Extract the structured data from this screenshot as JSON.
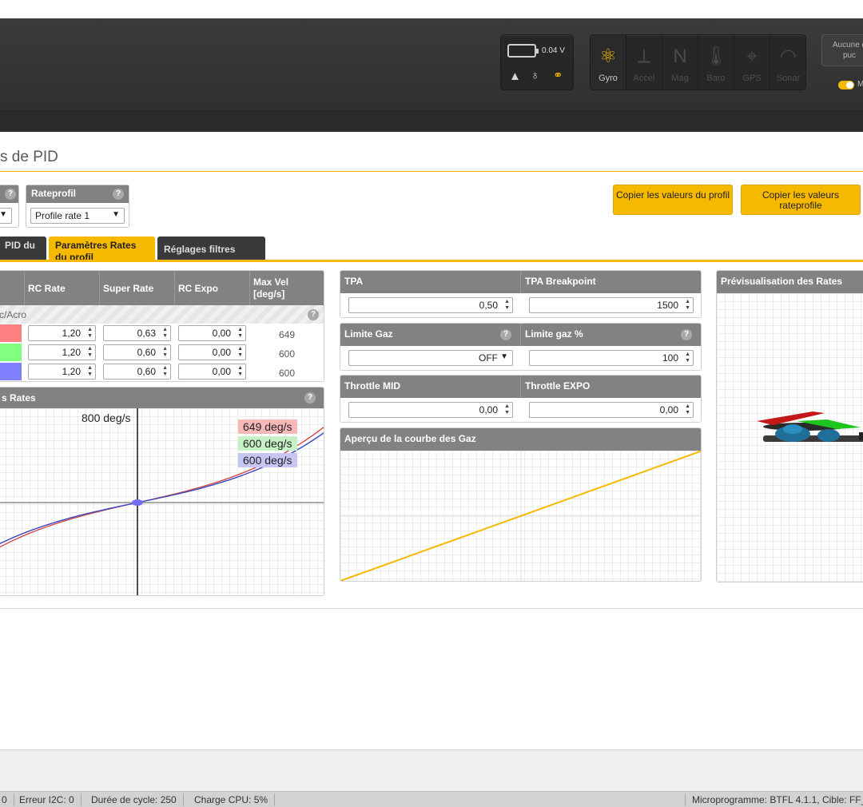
{
  "header": {
    "battery_voltage": "0.04 V",
    "sensors": [
      {
        "label": "Gyro",
        "icon": "gyro-icon",
        "active": true
      },
      {
        "label": "Accel",
        "icon": "accel-icon",
        "active": false
      },
      {
        "label": "Mag",
        "icon": "mag-icon",
        "active": false
      },
      {
        "label": "Baro",
        "icon": "baro-icon",
        "active": false
      },
      {
        "label": "GPS",
        "icon": "gps-icon",
        "active": false
      },
      {
        "label": "Sonar",
        "icon": "sonar-icon",
        "active": false
      }
    ],
    "connect_button_line1": "Aucune d",
    "connect_button_line2": "puc",
    "toggle_label": "M",
    "accent_color": "#f6b900"
  },
  "page": {
    "title": "s de PID"
  },
  "profiles": {
    "rateprofile_label": "Rateprofil",
    "rateprofile_value": "Profile rate 1",
    "copy_profile_button": "Copier les valeurs du profil",
    "copy_rateprofile_button": "Copier les valeurs rateprofile"
  },
  "tabs": [
    {
      "label": "PID du",
      "active": false
    },
    {
      "label": "Paramètres Rates du profil",
      "active": true
    },
    {
      "label": "Réglages filtres",
      "active": false
    }
  ],
  "rates_table": {
    "headers": [
      "RC Rate",
      "Super Rate",
      "RC Expo",
      "Max Vel [deg/s]"
    ],
    "subheader": "c/Acro",
    "rows": [
      {
        "axis_color": "#ff8080",
        "rc_rate": "1,20",
        "super_rate": "0,63",
        "rc_expo": "0,00",
        "max_vel": "649"
      },
      {
        "axis_color": "#80ff80",
        "rc_rate": "1,20",
        "super_rate": "0,60",
        "rc_expo": "0,00",
        "max_vel": "600"
      },
      {
        "axis_color": "#8080ff",
        "rc_rate": "1,20",
        "super_rate": "0,60",
        "rc_expo": "0,00",
        "max_vel": "600"
      }
    ]
  },
  "rates_graph": {
    "title": "s Rates",
    "top_label": "800 deg/s",
    "legend": [
      {
        "text": "649 deg/s",
        "color": "#f7b8b8",
        "line": "#d04040",
        "max": 649
      },
      {
        "text": "600 deg/s",
        "color": "#c6f0c6",
        "line": "#40c040",
        "max": 600
      },
      {
        "text": "600 deg/s",
        "color": "#c6c6f4",
        "line": "#4040d0",
        "max": 600
      }
    ]
  },
  "throttle": {
    "tpa_label": "TPA",
    "tpa_value": "0,50",
    "tpa_breakpoint_label": "TPA Breakpoint",
    "tpa_breakpoint_value": "1500",
    "limit_label": "Limite Gaz",
    "limit_value": "OFF",
    "limit_percent_label": "Limite gaz %",
    "limit_percent_value": "100",
    "mid_label": "Throttle MID",
    "mid_value": "0,00",
    "expo_label": "Throttle EXPO",
    "expo_value": "0,00",
    "curve_title": "Aperçu de la courbe des Gaz",
    "curve_color": "#f6b900"
  },
  "preview": {
    "title": "Prévisualisation des Rates"
  },
  "statusbar": {
    "item0": "0",
    "i2c": "Erreur I2C: 0",
    "cycle": "Durée de cycle: 250",
    "cpu": "Charge CPU: 5%",
    "firmware": "Microprogramme: BTFL 4.1.1, Cible: FF_"
  }
}
